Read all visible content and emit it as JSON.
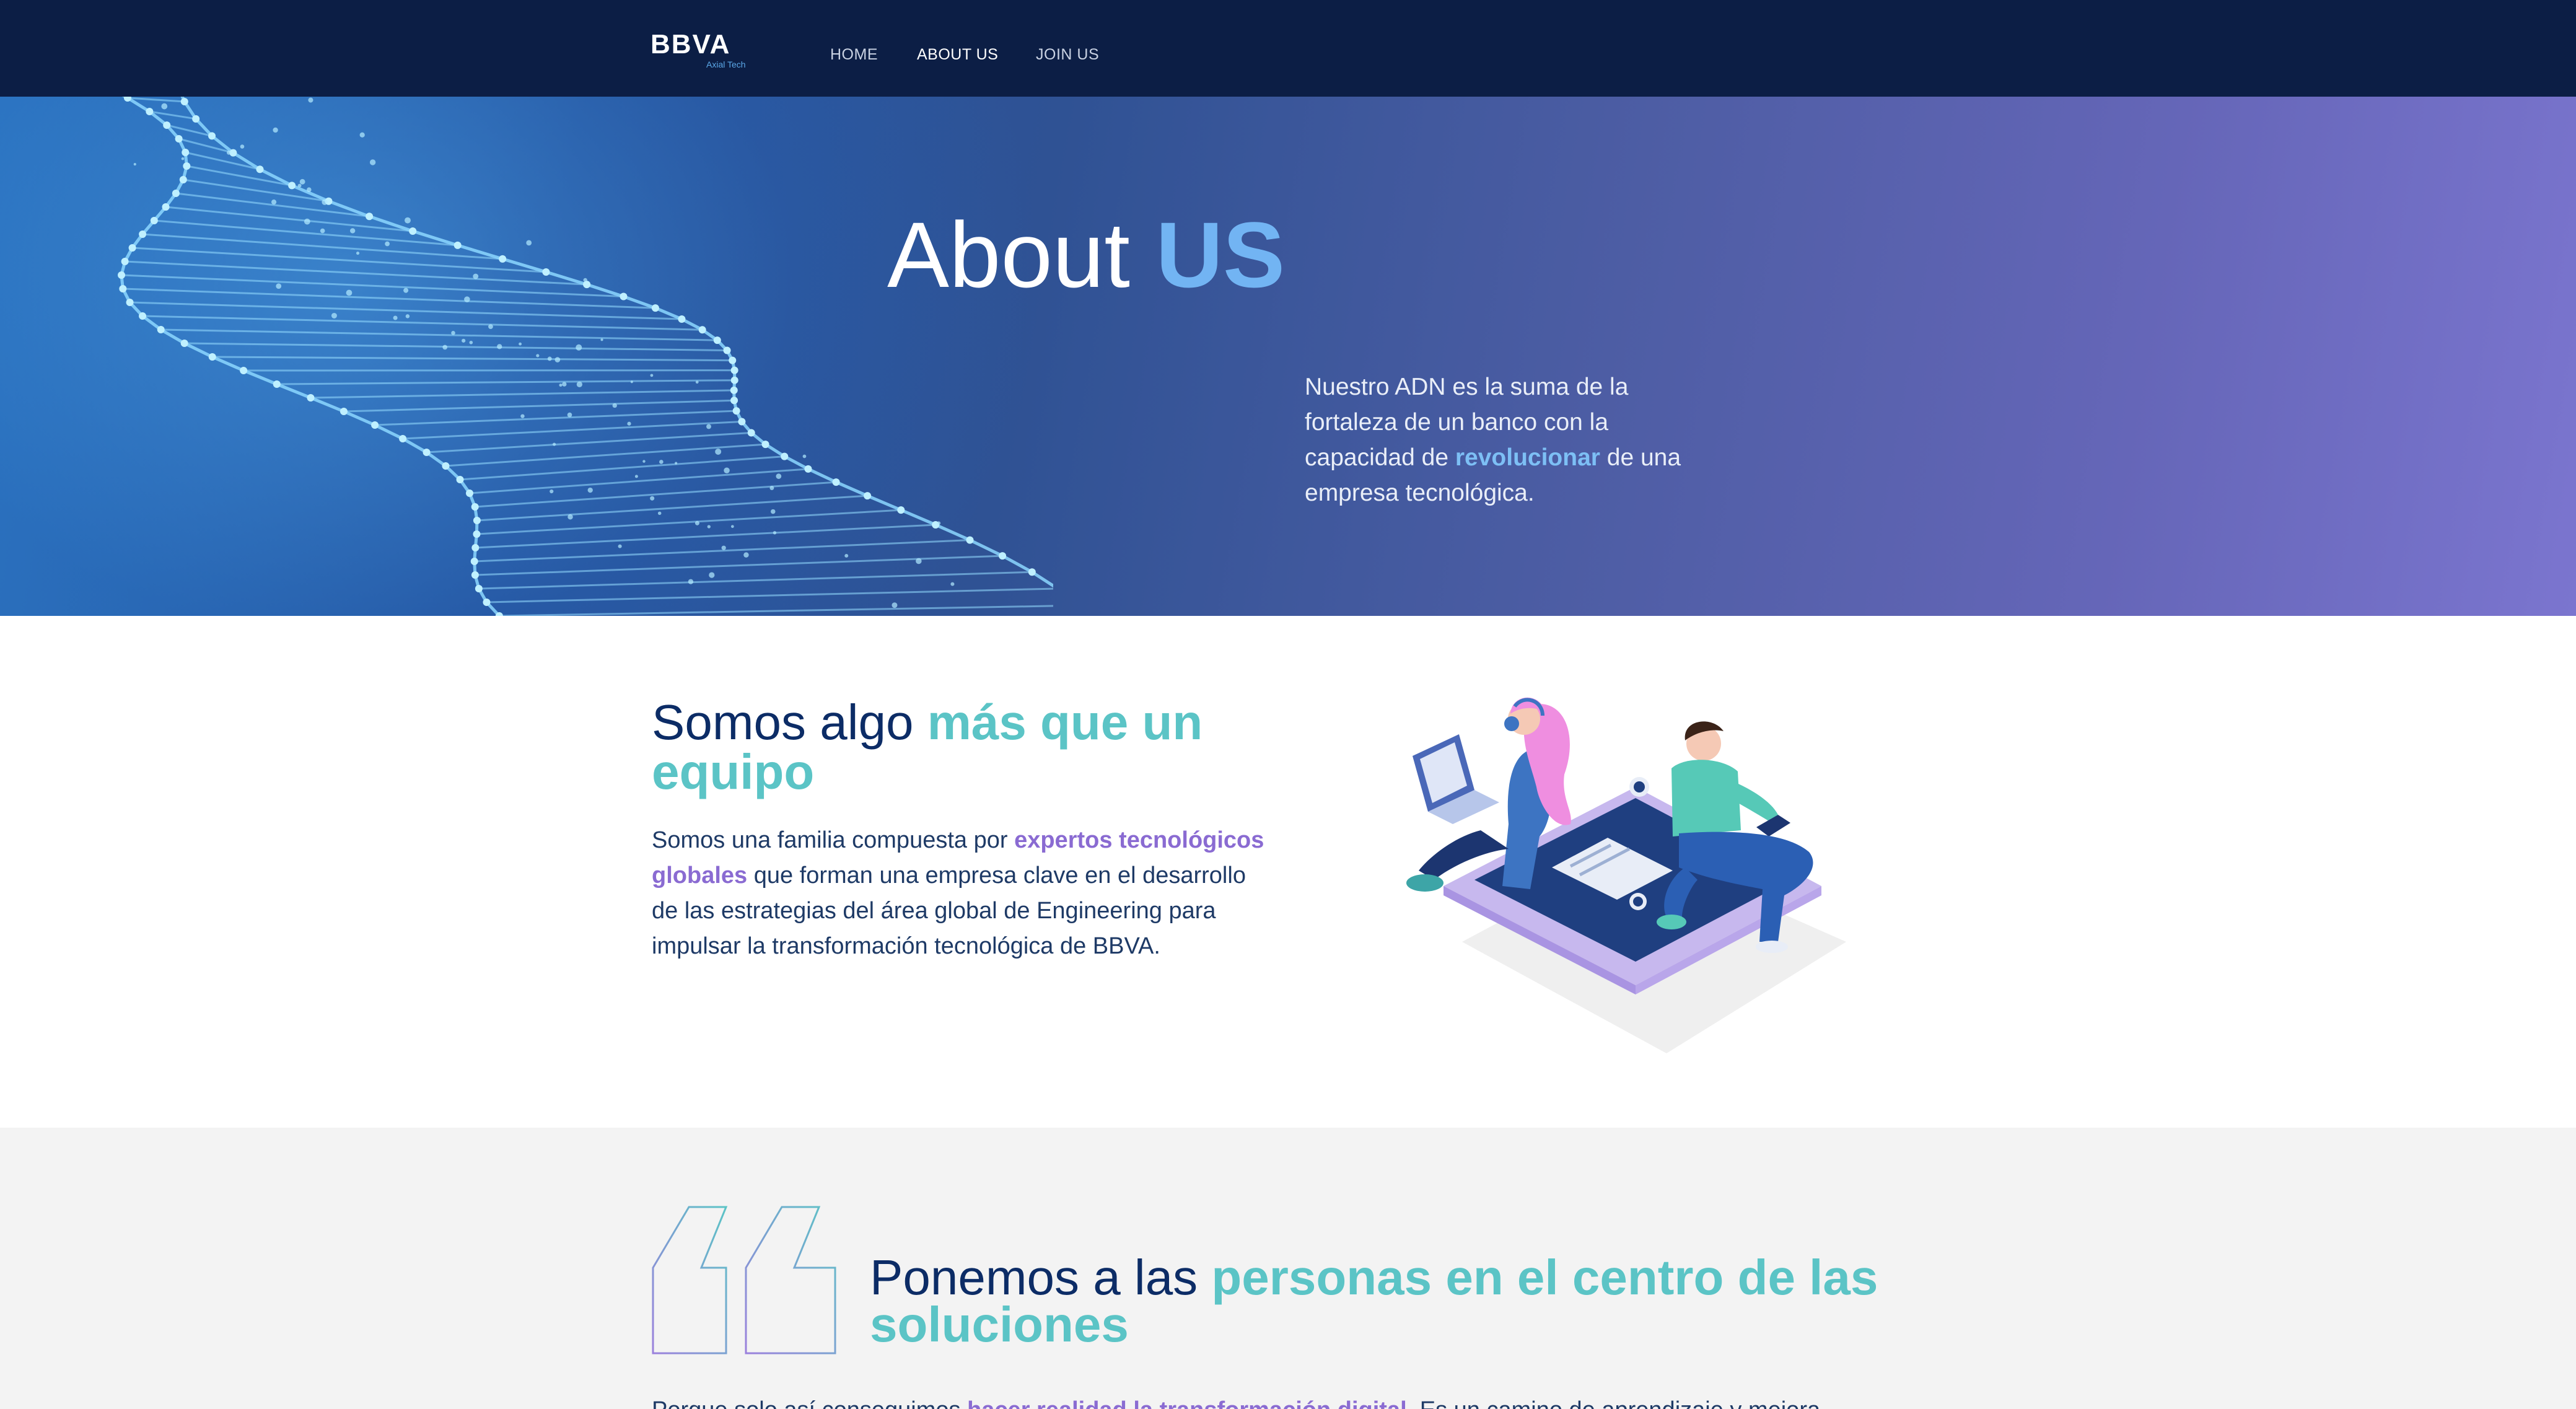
{
  "nav": {
    "logo": "BBVA",
    "logo_sub": "Axial Tech",
    "links": [
      "HOME",
      "ABOUT US",
      "JOIN US"
    ],
    "active": "ABOUT US"
  },
  "hero": {
    "title_pre": "About ",
    "title_hl": "US",
    "text_pre": "Nuestro ADN es la suma de la fortaleza de un banco con la capacidad de ",
    "text_hl": "revolucionar",
    "text_post": " de una empresa tecnológica."
  },
  "team": {
    "title_pre": "Somos algo ",
    "title_hl": "más que un equipo",
    "text_pre": "Somos una familia compuesta por ",
    "text_hl": "expertos tecnológicos globales",
    "text_post": " que forman una empresa clave en el desarrollo de las estrategias del área global de Engineering para impulsar la transformación tecnológica de BBVA."
  },
  "quote": {
    "title_pre": "Ponemos a las ",
    "title_hl": "personas en el centro de las soluciones",
    "text_pre": "Porque solo así conseguimos ",
    "text_hl": "hacer realidad la transformación digital",
    "text_post": ". Es un camino de aprendizaje y mejora"
  },
  "colors": {
    "nav_bg": "#0c1e45",
    "accent_teal": "#5bc4c6",
    "accent_purple": "#8a6bd2",
    "accent_blue": "#72b4f3",
    "text_dark": "#0c2c66",
    "section_gray": "#f3f3f3"
  },
  "icons": {
    "quote": "quote-marks-icon",
    "illustration": "team-illustration",
    "dna": "dna-helix-graphic"
  }
}
